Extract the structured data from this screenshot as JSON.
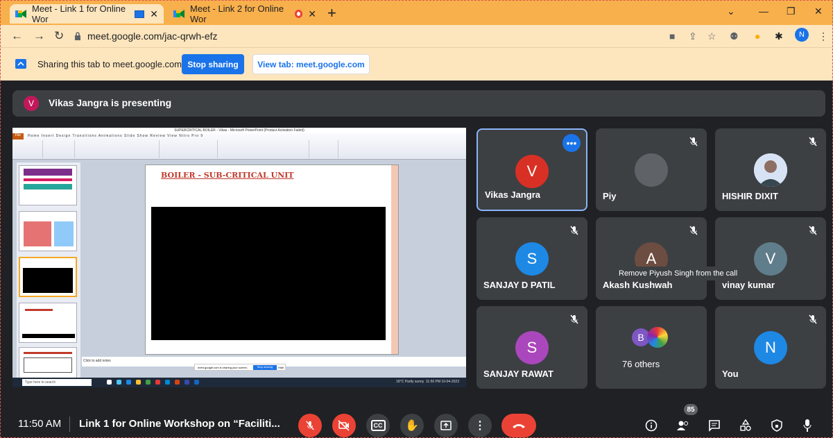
{
  "browser": {
    "tabs": [
      {
        "title": "Meet - Link 1 for Online Wor",
        "active": true
      },
      {
        "title": "Meet - Link 2 for Online Wor",
        "active": false
      }
    ],
    "new_tab": "+",
    "url": "meet.google.com/jac-qrwh-efz",
    "profile_initial": "N"
  },
  "share_bar": {
    "text": "Sharing this tab to meet.google.com",
    "stop_label": "Stop sharing",
    "view_label": "View tab: meet.google.com"
  },
  "presenter": {
    "initial": "V",
    "text": "Vikas Jangra is presenting"
  },
  "shared_screen": {
    "window_title": "SUPERCRITICAL BOILER - Vikas - Microsoft PowerPoint (Product Activation Failed)",
    "ribbon_tabs": "Home  Insert  Design  Transitions  Animations  Slide Show  Review  View  Nitro Pro 9",
    "file_tab": "File",
    "slide_title": "BOILER - SUB-CRITICAL UNIT",
    "notes_placeholder": "Click to add notes",
    "mini_share_text": "meet.google.com is sharing your screen.",
    "mini_stop": "Stop sharing",
    "mini_hide": "Hide",
    "taskbar_search": "Type here to search",
    "tray_weather": "18°C Partly sunny",
    "tray_time": "11:50 PM",
    "tray_date": "10-04-2023"
  },
  "tiles": [
    {
      "name": "Vikas Jangra",
      "initial": "V",
      "color": "#d93025",
      "active": true
    },
    {
      "name": "Piyush Singh",
      "initial": "",
      "color": "#5f6368",
      "active": false
    },
    {
      "name": "SHISHIR DIXIT",
      "initial": "",
      "color": "#8ab4f8",
      "active": false
    },
    {
      "name": "SANJAY D PATIL",
      "initial": "S",
      "color": "#1e88e5",
      "active": false
    },
    {
      "name": "Akash Kushwah",
      "initial": "A",
      "color": "#6d4c41",
      "active": false
    },
    {
      "name": "vinay kumar",
      "initial": "V",
      "color": "#607d8b",
      "active": false
    },
    {
      "name": "SANJAY RAWAT",
      "initial": "S",
      "color": "#ab47bc",
      "active": false
    },
    {
      "name": "76 others",
      "initial": "B",
      "color": "#7e57c2",
      "active": false
    },
    {
      "name": "You",
      "initial": "N",
      "color": "#1e88e5",
      "active": false
    }
  ],
  "tile_names_shown": {
    "piyush": "Piy",
    "shishir": "HISHIR DIXIT"
  },
  "tooltip": "Remove Piyush Singh from the call",
  "bottom_bar": {
    "time": "11:50 AM",
    "separator": "|",
    "meeting_title": "Link 1 for Online Workshop on “Faciliti...",
    "participants_count": "85",
    "cc_label": "CC"
  },
  "colors": {
    "tab_strip": "#f8b04c",
    "toolbar": "#fde5bd",
    "accent": "#1a73e8",
    "danger": "#ea4335",
    "meet_bg": "#202124",
    "tile_bg": "#3c4043"
  }
}
